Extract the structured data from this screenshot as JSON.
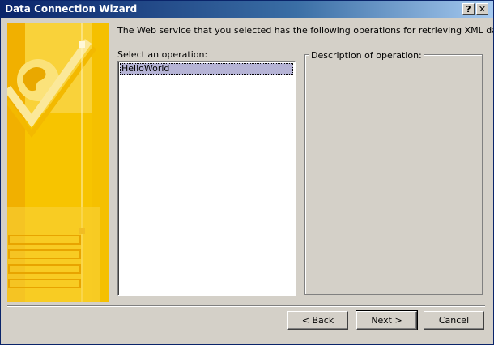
{
  "window": {
    "title": "Data Connection Wizard",
    "help_glyph": "?",
    "close_glyph": "✕"
  },
  "header": {
    "text": "The Web service that you selected has the following operations for retrieving XML data."
  },
  "operations": {
    "label": "Select an operation:",
    "items": [
      "HelloWorld"
    ],
    "selected": "HelloWorld"
  },
  "description": {
    "title": "Description of operation:",
    "text": ""
  },
  "buttons": {
    "back": "< Back",
    "next": "Next >",
    "cancel": "Cancel"
  },
  "icons": {
    "banner": "globe-checkmark-banner",
    "help": "help-icon",
    "close": "close-icon"
  },
  "colors": {
    "title_bar_start": "#0a246a",
    "title_bar_end": "#a6caf0",
    "dialog_face": "#d4d0c8",
    "banner_yellow": "#f7c400",
    "selection": "#b6b4d6"
  }
}
